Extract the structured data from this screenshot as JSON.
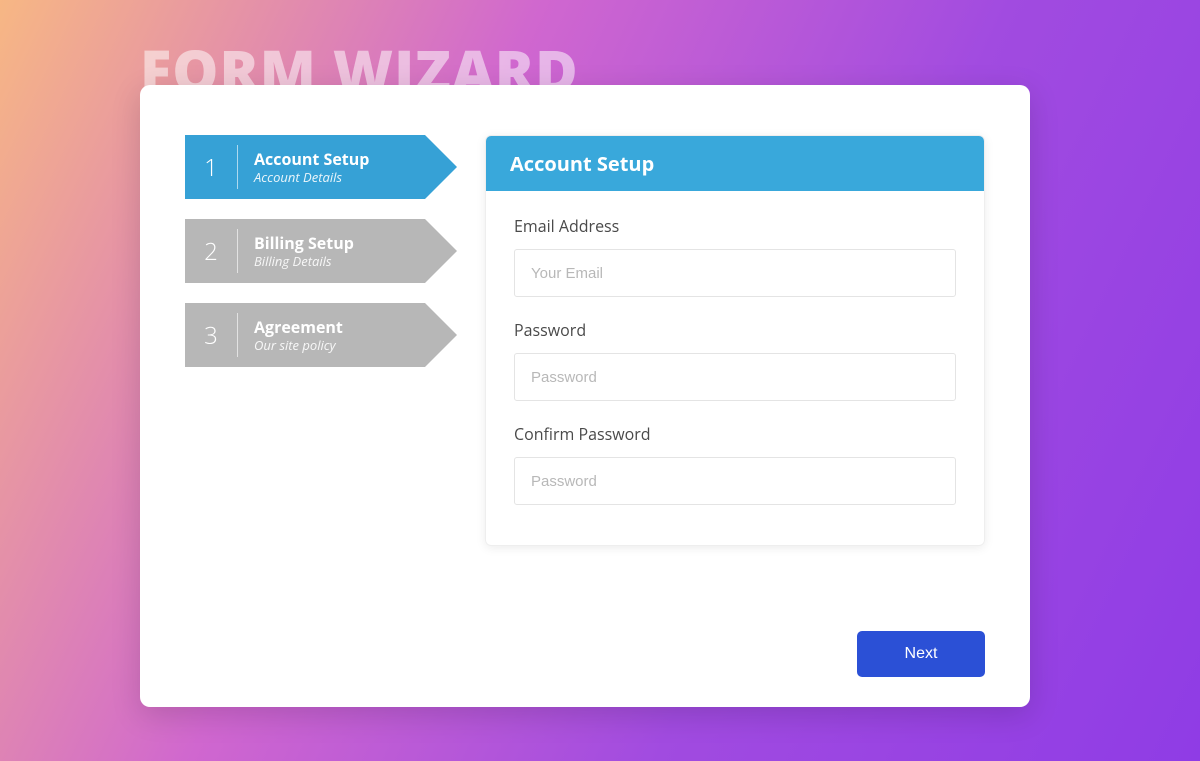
{
  "pageTitle": "FORM WIZARD",
  "steps": [
    {
      "num": "1",
      "label": "Account Setup",
      "sub": "Account Details",
      "active": true
    },
    {
      "num": "2",
      "label": "Billing Setup",
      "sub": "Billing Details",
      "active": false
    },
    {
      "num": "3",
      "label": "Agreement",
      "sub": "Our site policy",
      "active": false
    }
  ],
  "panel": {
    "title": "Account Setup",
    "fields": {
      "email": {
        "label": "Email Address",
        "placeholder": "Your Email",
        "value": ""
      },
      "password": {
        "label": "Password",
        "placeholder": "Password",
        "value": ""
      },
      "confirm": {
        "label": "Confirm Password",
        "placeholder": "Password",
        "value": ""
      }
    }
  },
  "actions": {
    "next": "Next"
  },
  "colors": {
    "stepActive": "#36a1d6",
    "stepInactive": "#b7b7b7",
    "primaryBtn": "#2b50d6"
  }
}
